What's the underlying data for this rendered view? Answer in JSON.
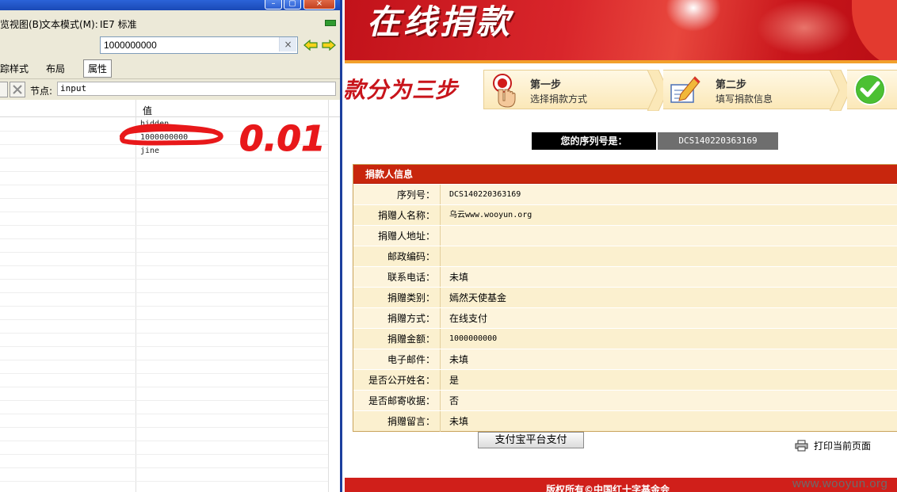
{
  "devtools": {
    "menu": {
      "view_item": "览视图(B)",
      "text_mode_item": "文本模式(M):",
      "text_mode_value": "IE7 标准"
    },
    "url_value": "1000000000",
    "clear_label": "×",
    "tabs": [
      "踪样式",
      "布局",
      "属性"
    ],
    "node_label": "节点:",
    "node_value": "input",
    "column_value_header": "值",
    "rows": [
      "hidden",
      "1000000000",
      "jine"
    ],
    "annotation": "0.01",
    "colors": {
      "scribble": "#e8181a",
      "titlebar": "#2b63d8"
    }
  },
  "page": {
    "banner_title": "在线捐款",
    "big_heading": "款分为三步",
    "steps": [
      {
        "title": "第一步",
        "sub": "选择捐款方式",
        "icon": "hand-pointer-icon"
      },
      {
        "title": "第二步",
        "sub": "填写捐款信息",
        "icon": "pen-form-icon"
      },
      {
        "icon": "green-check-icon"
      }
    ],
    "serial_label": "您的序列号是：",
    "serial_value": "DCS140220363169",
    "section_title": "捐款人信息",
    "fields": [
      {
        "k": "序列号：",
        "v": "DCS140220363169"
      },
      {
        "k": "捐赠人名称：",
        "v": "乌云www.wooyun.org"
      },
      {
        "k": "捐赠人地址：",
        "v": ""
      },
      {
        "k": "邮政编码：",
        "v": ""
      },
      {
        "k": "联系电话：",
        "v": "未填"
      },
      {
        "k": "捐赠类别：",
        "v": "嫣然天使基金"
      },
      {
        "k": "捐赠方式：",
        "v": "在线支付"
      },
      {
        "k": "捐赠金额：",
        "v": "1000000000"
      },
      {
        "k": "电子邮件：",
        "v": "未填"
      },
      {
        "k": "是否公开姓名：",
        "v": "是"
      },
      {
        "k": "是否邮寄收据：",
        "v": "否"
      },
      {
        "k": "捐赠留言：",
        "v": "未填"
      }
    ],
    "pay_button": "支付宝平台支付",
    "print_link": "打印当前页面",
    "footer": "版权所有©中国红十字基金会",
    "watermark": "www.wooyun.org",
    "colors": {
      "banner": "#c2121a",
      "table_header": "#c8260d",
      "footer": "#d01f1a"
    }
  }
}
